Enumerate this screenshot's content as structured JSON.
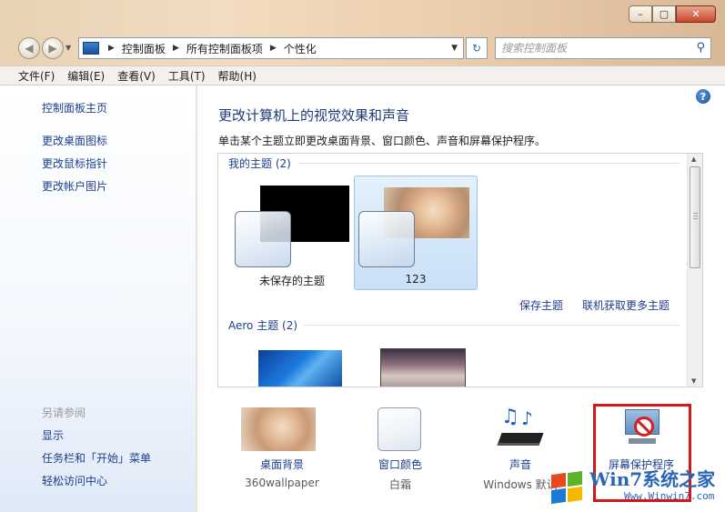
{
  "titlebar": {
    "min": "–",
    "max": "▢",
    "close": "✕"
  },
  "nav": {
    "back": "◀",
    "forward": "▶",
    "dropdown": "▼",
    "breadcrumbs": [
      "控制面板",
      "所有控制面板项",
      "个性化"
    ],
    "refresh": "↻",
    "search_placeholder": "搜索控制面板"
  },
  "menu": [
    "文件(F)",
    "编辑(E)",
    "查看(V)",
    "工具(T)",
    "帮助(H)"
  ],
  "sidebar": {
    "home": "控制面板主页",
    "links": [
      "更改桌面图标",
      "更改鼠标指针",
      "更改帐户图片"
    ],
    "see_also_heading": "另请参阅",
    "see_also": [
      "显示",
      "任务栏和「开始」菜单",
      "轻松访问中心"
    ]
  },
  "main": {
    "help": "?",
    "title": "更改计算机上的视觉效果和声音",
    "description": "单击某个主题立即更改桌面背景、窗口颜色、声音和屏幕保护程序。",
    "my_themes_heading": "我的主题 (2)",
    "my_themes": [
      {
        "label": "未保存的主题",
        "selected": false
      },
      {
        "label": "123",
        "selected": true
      }
    ],
    "save_theme": "保存主题",
    "get_more": "联机获取更多主题",
    "aero_heading": "Aero 主题 (2)"
  },
  "settings": [
    {
      "name": "桌面背景",
      "value": "360wallpaper",
      "icon": "wallpaper-icon"
    },
    {
      "name": "窗口颜色",
      "value": "白霜",
      "icon": "window-color-icon"
    },
    {
      "name": "声音",
      "value": "Windows 默认",
      "icon": "sound-icon"
    },
    {
      "name": "屏幕保护程序",
      "value": "",
      "icon": "screensaver-icon"
    }
  ],
  "watermark": {
    "title": "Win7系统之家",
    "url": "Www.Winwin7.com"
  },
  "colors": {
    "link": "#1d3e8f",
    "title": "#1e3a7a",
    "highlight": "#d01818",
    "selection": "#c9e0f7"
  }
}
